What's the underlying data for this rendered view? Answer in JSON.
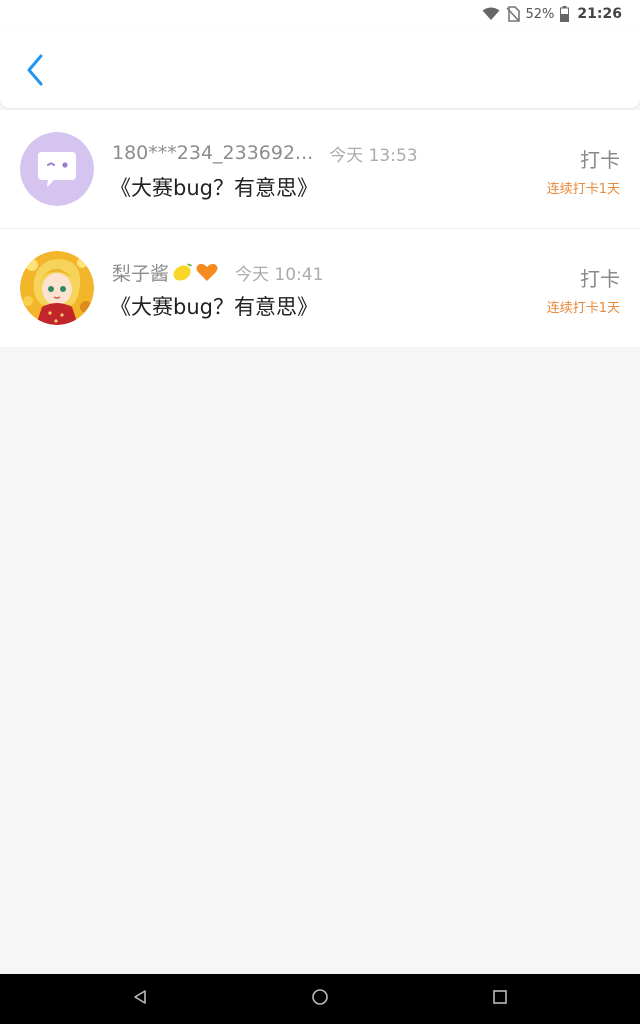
{
  "status_bar": {
    "battery": "52%",
    "time": "21:26",
    "icons": [
      "wifi-icon",
      "no-sim-icon",
      "battery-icon"
    ]
  },
  "header": {
    "back_icon": "chevron-left-icon",
    "accent_color": "#2196f3"
  },
  "records": [
    {
      "username": "180***234_233692...",
      "emoji": [],
      "time": "今天 13:53",
      "title": "《大赛bug？有意思》",
      "action": "打卡",
      "streak": "连续打卡1天",
      "avatar_icon": "chat-bubble-wink-icon"
    },
    {
      "username": "梨子酱",
      "emoji": [
        "lemon-emoji",
        "orange-heart-emoji"
      ],
      "time": "今天 10:41",
      "title": "《大赛bug？有意思》",
      "action": "打卡",
      "streak": "连续打卡1天",
      "avatar_icon": "anime-girl-avatar"
    }
  ],
  "nav_bar": {
    "buttons": [
      "back-triangle-icon",
      "home-circle-icon",
      "recents-square-icon"
    ]
  },
  "colors": {
    "streak": "#e8893a",
    "background": "#f7f6f7",
    "avatar_purple": "#d6c4f0"
  }
}
